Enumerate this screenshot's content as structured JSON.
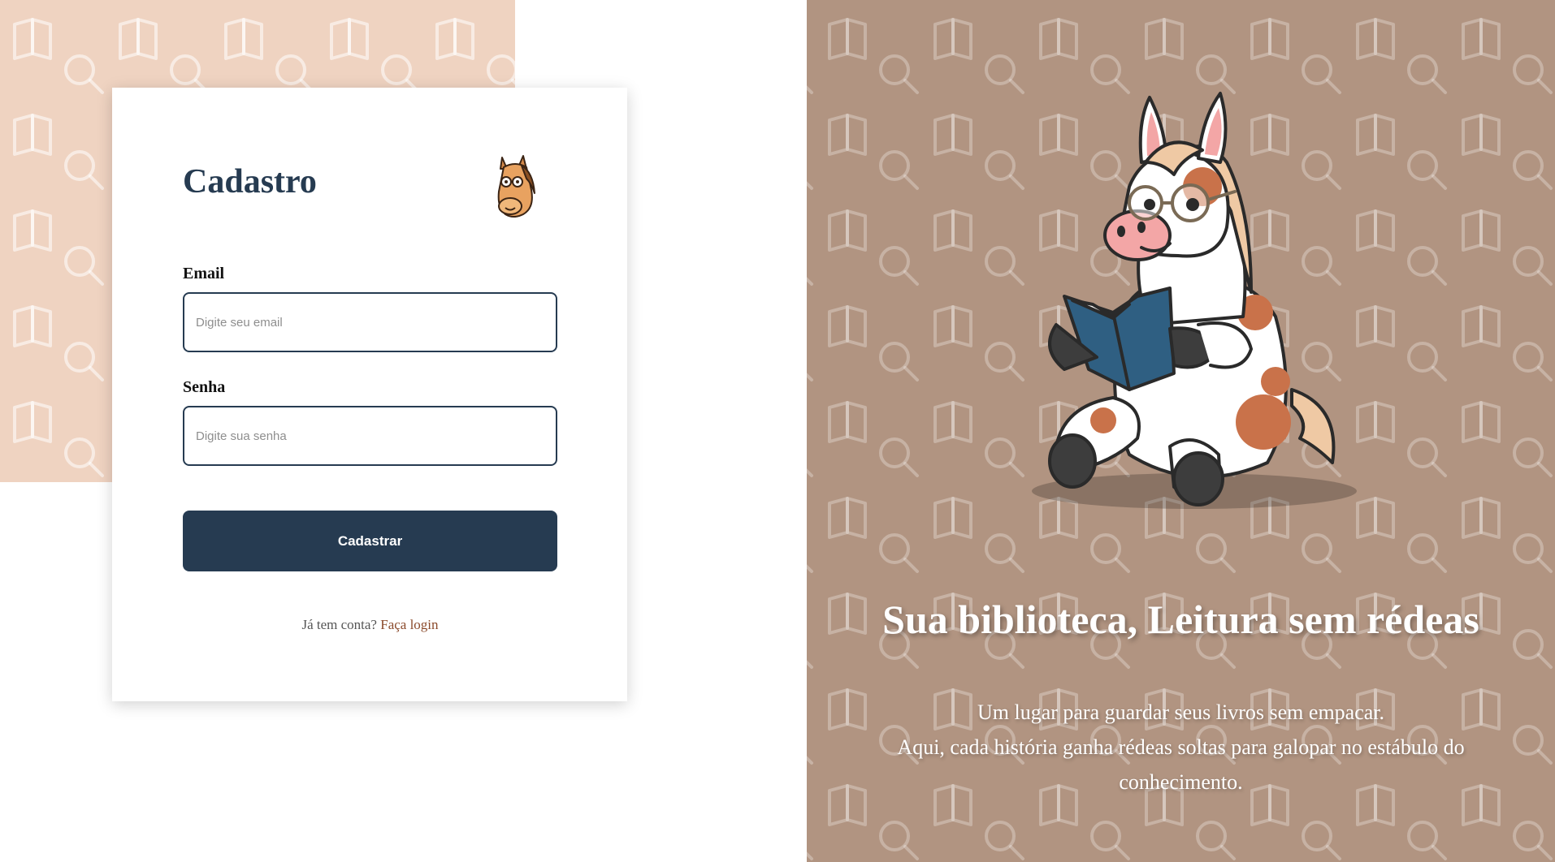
{
  "signup": {
    "title": "Cadastro",
    "email": {
      "label": "Email",
      "placeholder": "Digite seu email"
    },
    "password": {
      "label": "Senha",
      "placeholder": "Digite sua senha"
    },
    "submit_label": "Cadastrar",
    "login_prompt": "Já tem conta?",
    "login_link": "Faça login"
  },
  "hero": {
    "title": "Sua biblioteca, Leitura sem rédeas",
    "line1": "Um lugar para guardar seus livros sem empacar.",
    "line2": "Aqui, cada história ganha rédeas soltas para galopar no estábulo do conhecimento."
  },
  "colors": {
    "primary": "#263b51",
    "link": "#8b4a2b",
    "light_panel": "#efd3c1",
    "dark_panel": "#b19481"
  },
  "icons": {
    "logo": "horse-with-glasses-icon",
    "pattern": [
      "open-book-icon",
      "magnifier-icon"
    ],
    "mascot": "horse-reading-book-illustration"
  }
}
